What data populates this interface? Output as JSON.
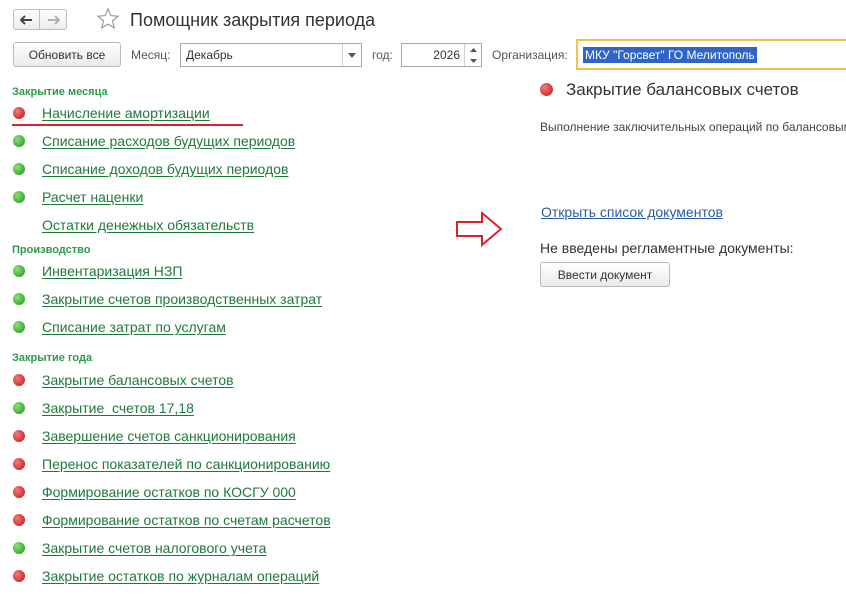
{
  "window": {
    "title": "Помощник закрытия периода"
  },
  "toolbar": {
    "refresh_label": "Обновить все",
    "month_label": "Месяц:",
    "month_value": "Декабрь",
    "year_label": "год:",
    "year_value": "2026",
    "org_label": "Организация:",
    "org_value": "МКУ \"Горсвет\" ГО Мелитополь"
  },
  "sections": [
    {
      "title": "Закрытие месяца",
      "items": [
        {
          "label": "Начисление амортизации",
          "status": "red"
        },
        {
          "label": "Списание расходов будущих периодов",
          "status": "green"
        },
        {
          "label": "Списание доходов будущих периодов",
          "status": "green"
        },
        {
          "label": "Расчет наценки",
          "status": "green"
        },
        {
          "label": "Остатки денежных обязательств",
          "status": "none"
        }
      ]
    },
    {
      "title": "Производство",
      "items": [
        {
          "label": "Инвентаризация НЗП",
          "status": "green"
        },
        {
          "label": "Закрытие счетов производственных затрат",
          "status": "green"
        },
        {
          "label": "Списание затрат по услугам",
          "status": "green"
        }
      ]
    },
    {
      "title": "Закрытие года",
      "items": [
        {
          "label": "Закрытие балансовых счетов",
          "status": "red"
        },
        {
          "label": "Закрытие  счетов 17,18",
          "status": "green"
        },
        {
          "label": "Завершение счетов санкционирования",
          "status": "red"
        },
        {
          "label": "Перенос показателей по санкционированию",
          "status": "red"
        },
        {
          "label": "Формирование остатков по КОСГУ 000",
          "status": "red"
        },
        {
          "label": "Формирование остатков по счетам расчетов",
          "status": "red"
        },
        {
          "label": "Закрытие счетов налогового учета",
          "status": "green"
        },
        {
          "label": "Закрытие остатков по журналам операций",
          "status": "red"
        }
      ]
    }
  ],
  "panel": {
    "status": "red",
    "title": "Закрытие балансовых счетов",
    "description": "Выполнение заключительных операций по балансовым",
    "open_list_link": "Открыть список документов",
    "no_docs_text": "Не введены регламентные документы:",
    "enter_doc_label": "Ввести документ"
  },
  "colors": {
    "link_green": "#1e7a3a",
    "section_green": "#2e9a4e",
    "status_red": "#d63a3a",
    "status_green": "#44b43a",
    "accent_red": "#e0212b",
    "link_blue": "#2a5aa8",
    "selection_blue": "#3264c8",
    "focus_yellow": "#f2c14e"
  }
}
